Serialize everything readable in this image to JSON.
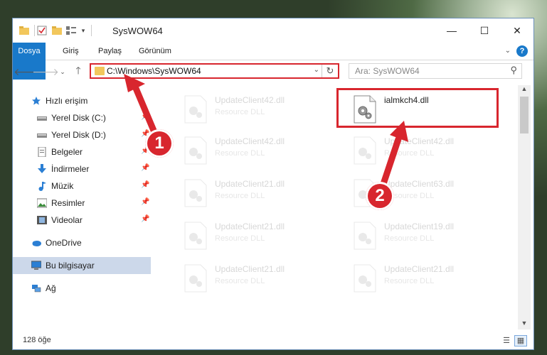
{
  "window": {
    "title": "SysWOW64",
    "minimize_label": "—",
    "maximize_label": "☐",
    "close_label": "✕"
  },
  "ribbon": {
    "tabs": [
      "Dosya",
      "Giriş",
      "Paylaş",
      "Görünüm"
    ],
    "help_label": "?"
  },
  "address_bar": {
    "path": "C:\\Windows\\SysWOW64"
  },
  "search": {
    "placeholder": "Ara: SysWOW64"
  },
  "nav_pane": {
    "items": [
      {
        "label": "Hızlı erişim",
        "icon": "star-icon"
      },
      {
        "label": "Yerel Disk (C:)",
        "icon": "drive-icon",
        "pinned": true
      },
      {
        "label": "Yerel Disk (D:)",
        "icon": "drive-icon",
        "pinned": true
      },
      {
        "label": "Belgeler",
        "icon": "documents-icon",
        "pinned": true
      },
      {
        "label": "İndirmeler",
        "icon": "download-icon",
        "pinned": true
      },
      {
        "label": "Müzik",
        "icon": "music-icon",
        "pinned": true
      },
      {
        "label": "Resimler",
        "icon": "pictures-icon",
        "pinned": true
      },
      {
        "label": "Videolar",
        "icon": "videos-icon",
        "pinned": true
      },
      {
        "label": "OneDrive",
        "icon": "cloud-icon"
      },
      {
        "label": "Bu bilgisayar",
        "icon": "computer-icon",
        "selected": true
      },
      {
        "label": "Ağ",
        "icon": "network-icon"
      }
    ]
  },
  "files": {
    "highlighted": {
      "name": "ialmkch4.dll",
      "type": ""
    },
    "left_column": [
      {
        "name": "UpdateClient42.dll",
        "type": "Resource DLL"
      },
      {
        "name": "UpdateClient42.dll",
        "type": "Resource DLL"
      },
      {
        "name": "UpdateClient21.dll",
        "type": "Resource DLL"
      },
      {
        "name": "UpdateClient21.dll",
        "type": "Resource DLL"
      },
      {
        "name": "UpdateClient21.dll",
        "type": "Resource DLL"
      }
    ],
    "right_column": [
      {
        "name": "UpdateClient42.dll",
        "type": "Resource DLL"
      },
      {
        "name": "UpdateClient63.dll",
        "type": "Resource DLL"
      },
      {
        "name": "UpdateClient19.dll",
        "type": "Resource DLL"
      },
      {
        "name": "UpdateClient21.dll",
        "type": "Resource DLL"
      }
    ]
  },
  "status_bar": {
    "item_count": "128 öğe"
  },
  "annotations": {
    "step1": "1",
    "step2": "2"
  },
  "colors": {
    "accent": "#1979ca",
    "highlight_red": "#d8262e",
    "selection": "#ccd8ea"
  }
}
